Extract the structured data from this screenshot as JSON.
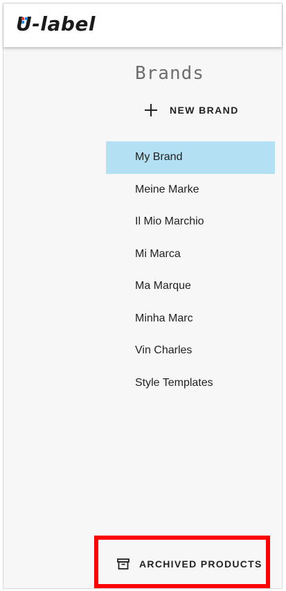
{
  "header": {
    "logo_text": "U-label"
  },
  "sidebar": {
    "title": "Brands",
    "new_brand_label": "NEW BRAND",
    "items": [
      {
        "label": "My Brand",
        "selected": true
      },
      {
        "label": "Meine Marke",
        "selected": false
      },
      {
        "label": "Il Mio Marchio",
        "selected": false
      },
      {
        "label": "Mi Marca",
        "selected": false
      },
      {
        "label": "Ma Marque",
        "selected": false
      },
      {
        "label": "Minha Marc",
        "selected": false
      },
      {
        "label": "Vin Charles",
        "selected": false
      },
      {
        "label": "Style Templates",
        "selected": false
      }
    ],
    "archived_label": "ARCHIVED PRODUCTS"
  },
  "colors": {
    "selected_background": "#b3e0f2",
    "highlight_border": "#ff0000",
    "logo_accent_red": "#e53935",
    "logo_accent_blue": "#1e88e5"
  },
  "icons": {
    "new_brand": "plus-icon",
    "archived": "archive-box-icon"
  }
}
